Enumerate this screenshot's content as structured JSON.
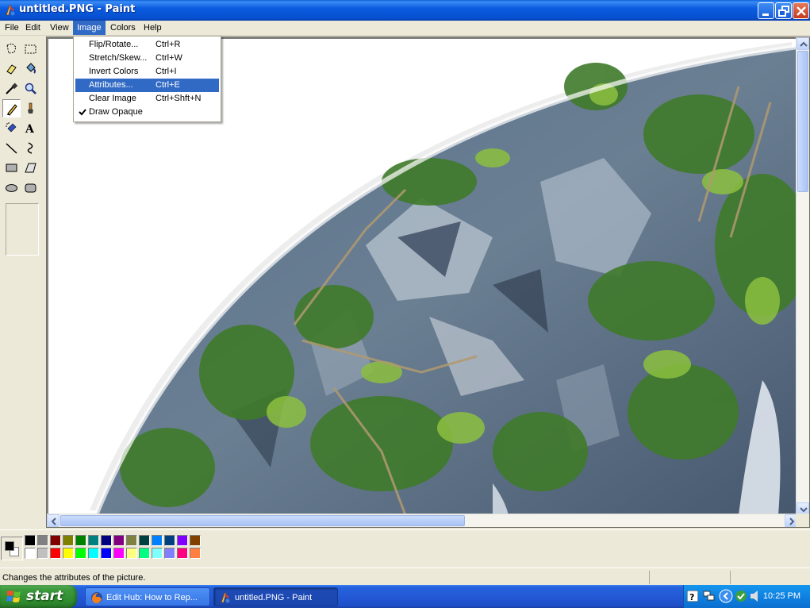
{
  "window": {
    "title": "untitled.PNG - Paint"
  },
  "menubar": {
    "items": [
      {
        "label": "File"
      },
      {
        "label": "Edit"
      },
      {
        "label": "View"
      },
      {
        "label": "Image",
        "active": true
      },
      {
        "label": "Colors"
      },
      {
        "label": "Help"
      }
    ]
  },
  "image_menu": {
    "items": [
      {
        "label": "Flip/Rotate...",
        "shortcut": "Ctrl+R"
      },
      {
        "label": "Stretch/Skew...",
        "shortcut": "Ctrl+W"
      },
      {
        "label": "Invert Colors",
        "shortcut": "Ctrl+I"
      },
      {
        "label": "Attributes...",
        "shortcut": "Ctrl+E",
        "highlighted": true
      },
      {
        "label": "Clear Image",
        "shortcut": "Ctrl+Shft+N"
      },
      {
        "label": "Draw Opaque",
        "shortcut": "",
        "checked": true
      }
    ]
  },
  "tools": [
    "free-form-select-icon",
    "select-icon",
    "eraser-icon",
    "fill-bucket-icon",
    "color-picker-icon",
    "magnifier-icon",
    "pencil-icon",
    "brush-icon",
    "airbrush-icon",
    "text-icon",
    "line-icon",
    "curve-icon",
    "rectangle-icon",
    "polygon-icon",
    "ellipse-icon",
    "rounded-rectangle-icon"
  ],
  "selected_tool": "pencil-icon",
  "palette": {
    "foreground": "#000000",
    "background": "#ffffff",
    "top_row": [
      "#000000",
      "#808080",
      "#800000",
      "#808000",
      "#008000",
      "#008080",
      "#000080",
      "#800080",
      "#808040",
      "#004040",
      "#0080ff",
      "#004080",
      "#8000ff",
      "#804000"
    ],
    "bottom_row": [
      "#ffffff",
      "#c0c0c0",
      "#ff0000",
      "#ffff00",
      "#00ff00",
      "#00ffff",
      "#0000ff",
      "#ff00ff",
      "#ffff80",
      "#00ff80",
      "#80ffff",
      "#8080ff",
      "#ff0080",
      "#ff8040"
    ]
  },
  "status": {
    "text": "Changes the attributes of the picture."
  },
  "taskbar": {
    "start_label": "start",
    "tasks": [
      {
        "label": "Edit Hub: How to Rep...",
        "icon": "firefox-icon",
        "active": false
      },
      {
        "label": "untitled.PNG - Paint",
        "icon": "paint-icon",
        "active": true
      }
    ],
    "clock": "10:25 PM"
  }
}
